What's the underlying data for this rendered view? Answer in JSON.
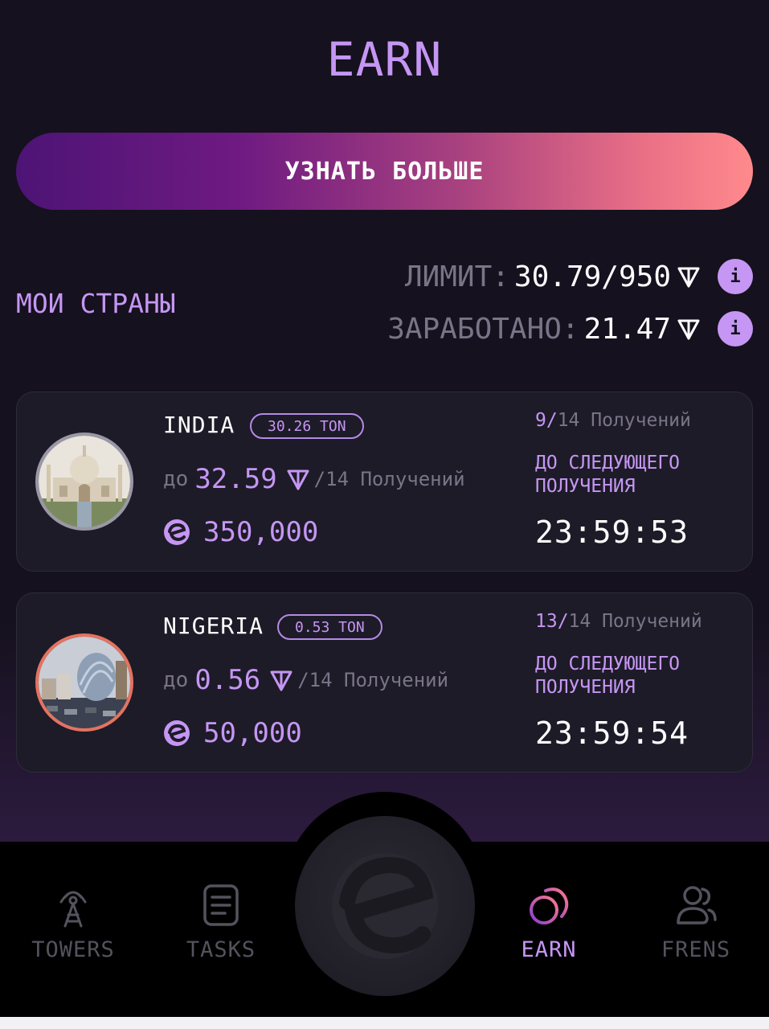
{
  "header": {
    "title": "EARN"
  },
  "learn_more": {
    "label": "УЗНАТЬ БОЛЬШЕ"
  },
  "section": {
    "title": "МОИ СТРАНЫ"
  },
  "stats": {
    "limit_label": "ЛИМИТ:",
    "limit_value": "30.79/950",
    "earned_label": "ЗАРАБОТАНО:",
    "earned_value": "21.47",
    "info_glyph": "i"
  },
  "countries": [
    {
      "name": "INDIA",
      "badge": "30.26 TON",
      "upto_prefix": "до",
      "upto_amount": "32.59",
      "upto_suffix": "/14 Получений",
      "price": "350,000",
      "count_current": "9/",
      "count_rest": "14 Получений",
      "next_label": "ДО СЛЕДУЮЩЕГО ПОЛУЧЕНИЯ",
      "timer": "23:59:53",
      "ring_color": "#9a98a6"
    },
    {
      "name": "NIGERIA",
      "badge": "0.53 TON",
      "upto_prefix": "до",
      "upto_amount": "0.56",
      "upto_suffix": "/14 Получений",
      "price": "50,000",
      "count_current": "13/",
      "count_rest": "14 Получений",
      "next_label": "ДО СЛЕДУЮЩЕГО ПОЛУЧЕНИЯ",
      "timer": "23:59:54",
      "ring_color": "#e4735f"
    }
  ],
  "nav": {
    "items": [
      {
        "label": "TOWERS",
        "icon": "tower-icon",
        "active": false
      },
      {
        "label": "TASKS",
        "icon": "tasks-icon",
        "active": false
      },
      {
        "label": "EARN",
        "icon": "earn-icon",
        "active": true
      },
      {
        "label": "FRENS",
        "icon": "frens-icon",
        "active": false
      }
    ],
    "center_icon": "logo-icon"
  },
  "colors": {
    "accent": "#c596f3",
    "background": "#15111e",
    "card": "#1d1b27",
    "muted": "#7a7488",
    "gradient_start": "#4d1475",
    "gradient_end": "#ff8a8c"
  }
}
